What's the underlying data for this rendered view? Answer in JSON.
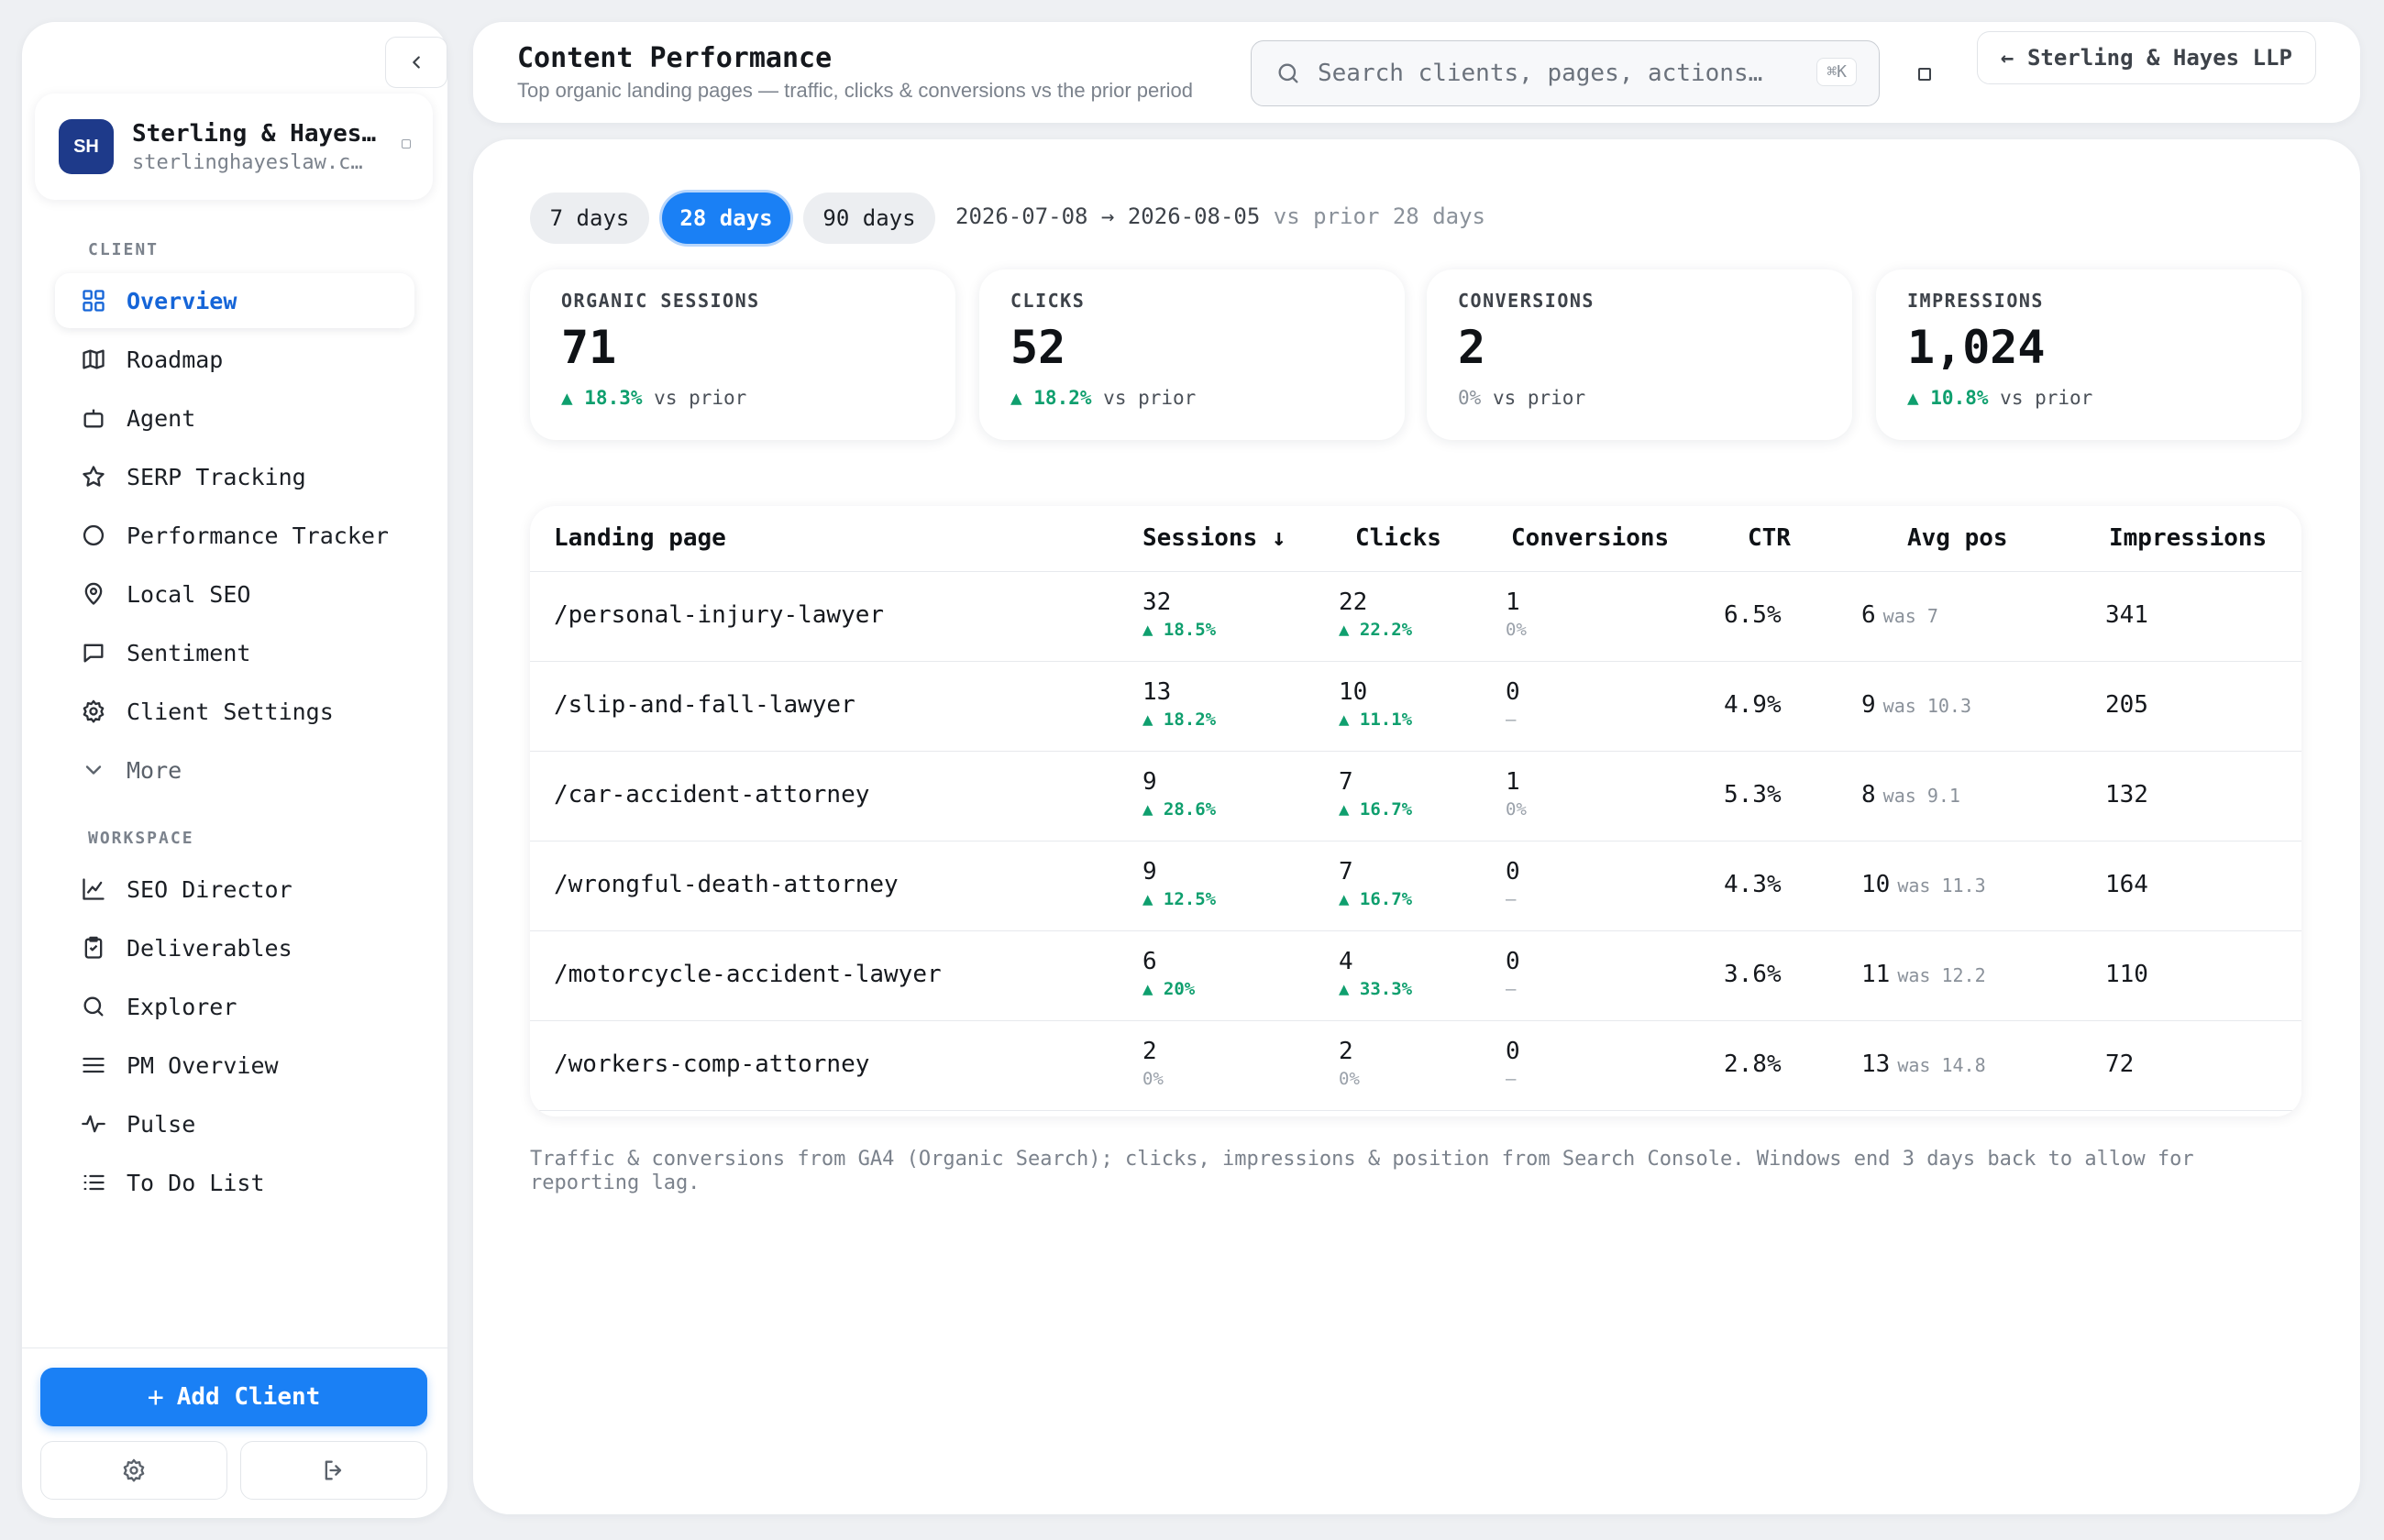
{
  "sidebar": {
    "client": {
      "initials": "SH",
      "name": "Sterling & Hayes…",
      "domain": "sterlinghayeslaw.c…"
    },
    "client_section": "CLIENT",
    "client_items": [
      {
        "label": "Overview",
        "icon": "grid-icon",
        "active": true
      },
      {
        "label": "Roadmap",
        "icon": "map-icon"
      },
      {
        "label": "Agent",
        "icon": "robot-icon"
      },
      {
        "label": "SERP Tracking",
        "icon": "star-icon"
      },
      {
        "label": "Performance Tracker",
        "icon": "circle-icon"
      },
      {
        "label": "Local SEO",
        "icon": "map-pin-icon"
      },
      {
        "label": "Sentiment",
        "icon": "chat-icon"
      },
      {
        "label": "Client Settings",
        "icon": "gear-icon"
      },
      {
        "label": "More",
        "icon": "chevron-down-icon"
      }
    ],
    "workspace_section": "WORKSPACE",
    "workspace_items": [
      {
        "label": "SEO Director",
        "icon": "line-chart-icon"
      },
      {
        "label": "Deliverables",
        "icon": "clipboard-icon"
      },
      {
        "label": "Explorer",
        "icon": "search-icon"
      },
      {
        "label": "PM Overview",
        "icon": "menu-icon"
      },
      {
        "label": "Pulse",
        "icon": "pulse-icon"
      },
      {
        "label": "To Do List",
        "icon": "list-icon"
      }
    ],
    "add_client_label": "Add Client"
  },
  "header": {
    "title": "Content Performance",
    "subtitle": "Top organic landing pages — traffic, clicks & conversions vs the prior period",
    "search_placeholder": "Search clients, pages, actions…",
    "search_shortcut": "⌘K",
    "back_label": "← Sterling & Hayes LLP"
  },
  "range": {
    "options": [
      "7 days",
      "28 days",
      "90 days"
    ],
    "selected": "28 days",
    "dates": "2026-07-08 → 2026-08-05",
    "compare": "vs prior 28 days"
  },
  "kpis": [
    {
      "label": "ORGANIC SESSIONS",
      "value": "71",
      "delta": "▲ 18.3%",
      "trend": "up",
      "suffix": "vs prior"
    },
    {
      "label": "CLICKS",
      "value": "52",
      "delta": "▲ 18.2%",
      "trend": "up",
      "suffix": "vs prior"
    },
    {
      "label": "CONVERSIONS",
      "value": "2",
      "delta": "0%",
      "trend": "flat",
      "suffix": "vs prior"
    },
    {
      "label": "IMPRESSIONS",
      "value": "1,024",
      "delta": "▲ 10.8%",
      "trend": "up",
      "suffix": "vs prior"
    }
  ],
  "table": {
    "columns": [
      "Landing page",
      "Sessions ↓",
      "Clicks",
      "Conversions",
      "CTR",
      "Avg pos",
      "Impressions"
    ],
    "rows": [
      {
        "page": "/personal-injury-lawyer",
        "sessions": "32",
        "sessions_delta": "▲ 18.5%",
        "sessions_trend": "up",
        "clicks": "22",
        "clicks_delta": "▲ 22.2%",
        "clicks_trend": "up",
        "conversions": "1",
        "conv_delta": "0%",
        "ctr": "6.5%",
        "pos": "6",
        "pos_was": "was 7",
        "impressions": "341"
      },
      {
        "page": "/slip-and-fall-lawyer",
        "sessions": "13",
        "sessions_delta": "▲ 18.2%",
        "sessions_trend": "up",
        "clicks": "10",
        "clicks_delta": "▲ 11.1%",
        "clicks_trend": "up",
        "conversions": "0",
        "conv_delta": "—",
        "ctr": "4.9%",
        "pos": "9",
        "pos_was": "was 10.3",
        "impressions": "205"
      },
      {
        "page": "/car-accident-attorney",
        "sessions": "9",
        "sessions_delta": "▲ 28.6%",
        "sessions_trend": "up",
        "clicks": "7",
        "clicks_delta": "▲ 16.7%",
        "clicks_trend": "up",
        "conversions": "1",
        "conv_delta": "0%",
        "ctr": "5.3%",
        "pos": "8",
        "pos_was": "was 9.1",
        "impressions": "132"
      },
      {
        "page": "/wrongful-death-attorney",
        "sessions": "9",
        "sessions_delta": "▲ 12.5%",
        "sessions_trend": "up",
        "clicks": "7",
        "clicks_delta": "▲ 16.7%",
        "clicks_trend": "up",
        "conversions": "0",
        "conv_delta": "—",
        "ctr": "4.3%",
        "pos": "10",
        "pos_was": "was 11.3",
        "impressions": "164"
      },
      {
        "page": "/motorcycle-accident-lawyer",
        "sessions": "6",
        "sessions_delta": "▲ 20%",
        "sessions_trend": "up",
        "clicks": "4",
        "clicks_delta": "▲ 33.3%",
        "clicks_trend": "up",
        "conversions": "0",
        "conv_delta": "—",
        "ctr": "3.6%",
        "pos": "11",
        "pos_was": "was 12.2",
        "impressions": "110"
      },
      {
        "page": "/workers-comp-attorney",
        "sessions": "2",
        "sessions_delta": "0%",
        "sessions_trend": "flat",
        "clicks": "2",
        "clicks_delta": "0%",
        "clicks_trend": "flat",
        "conversions": "0",
        "conv_delta": "—",
        "ctr": "2.8%",
        "pos": "13",
        "pos_was": "was 14.8",
        "impressions": "72"
      }
    ]
  },
  "footnote": "Traffic & conversions from GA4 (Organic Search); clicks, impressions & position from Search Console. Windows end 3 days back to allow for reporting lag.",
  "colors": {
    "accent": "#1a80f5",
    "positive": "#0f9f6e",
    "avatar": "#1e3a8a"
  }
}
